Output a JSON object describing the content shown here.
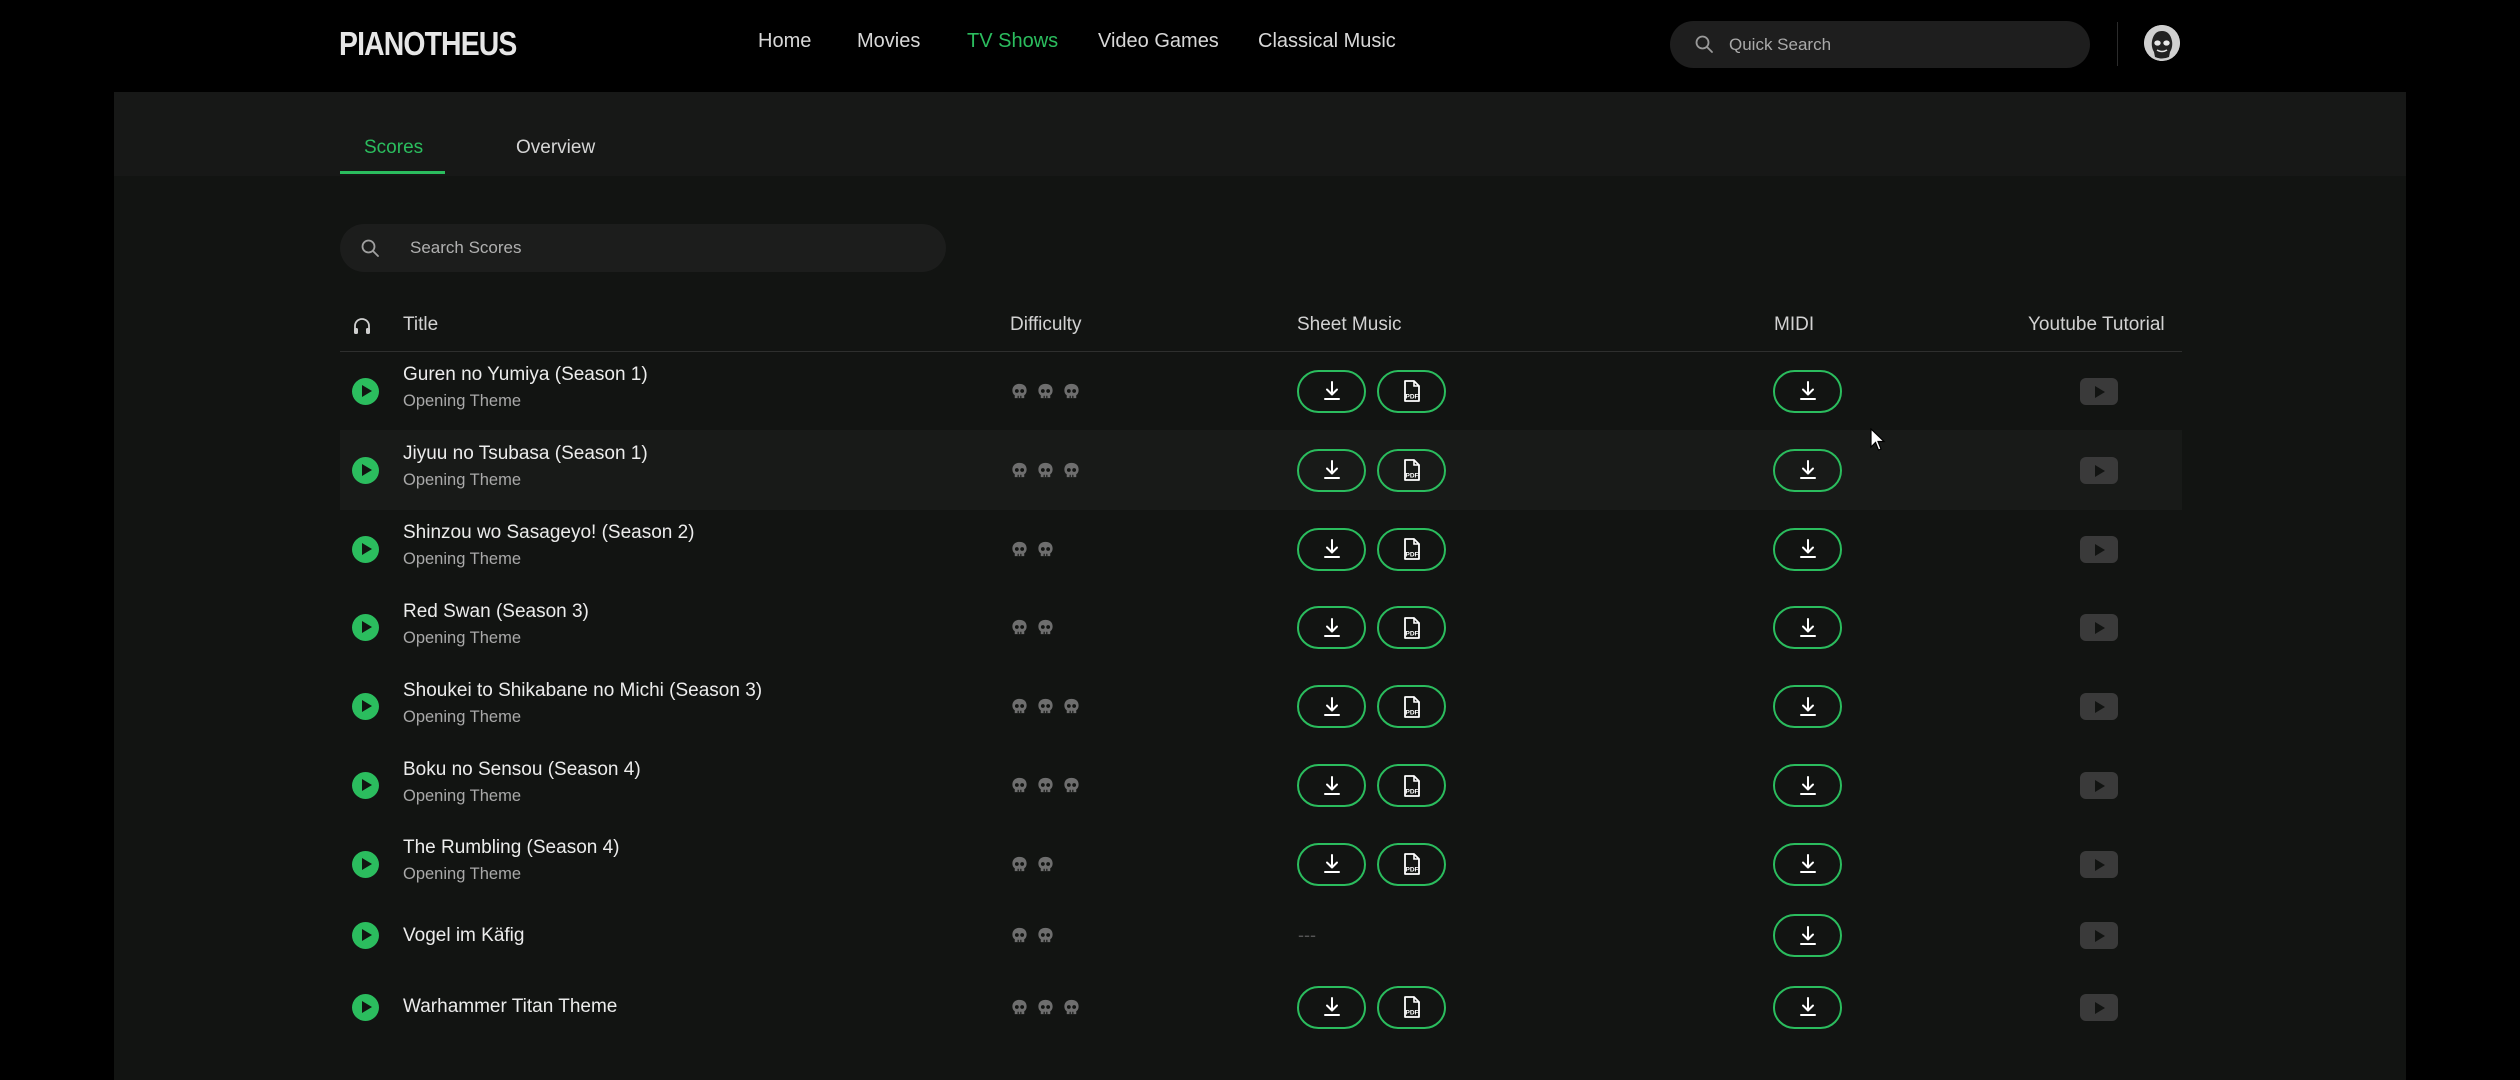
{
  "app": {
    "logo": "PIANOTHEUS"
  },
  "nav": {
    "items": [
      {
        "label": "Home",
        "active": false
      },
      {
        "label": "Movies",
        "active": false
      },
      {
        "label": "TV Shows",
        "active": true
      },
      {
        "label": "Video Games",
        "active": false
      },
      {
        "label": "Classical Music",
        "active": false
      }
    ],
    "search_placeholder": "Quick Search"
  },
  "tabs": [
    {
      "label": "Scores",
      "active": true
    },
    {
      "label": "Overview",
      "active": false
    }
  ],
  "scores_search": {
    "placeholder": "Search Scores"
  },
  "table": {
    "headers": {
      "title": "Title",
      "difficulty": "Difficulty",
      "sheet_music": "Sheet Music",
      "midi": "MIDI",
      "youtube": "Youtube Tutorial"
    },
    "rows": [
      {
        "title": "Guren no Yumiya (Season 1)",
        "subtitle": "Opening Theme",
        "difficulty": 3,
        "sheet_music": true
      },
      {
        "title": "Jiyuu no Tsubasa (Season 1)",
        "subtitle": "Opening Theme",
        "difficulty": 3,
        "sheet_music": true
      },
      {
        "title": "Shinzou wo Sasageyo! (Season 2)",
        "subtitle": "Opening Theme",
        "difficulty": 2,
        "sheet_music": true
      },
      {
        "title": "Red Swan (Season 3)",
        "subtitle": "Opening Theme",
        "difficulty": 2,
        "sheet_music": true
      },
      {
        "title": "Shoukei to Shikabane no Michi (Season 3)",
        "subtitle": "Opening Theme",
        "difficulty": 3,
        "sheet_music": true
      },
      {
        "title": "Boku no Sensou (Season 4)",
        "subtitle": "Opening Theme",
        "difficulty": 3,
        "sheet_music": true
      },
      {
        "title": "The Rumbling (Season 4)",
        "subtitle": "Opening Theme",
        "difficulty": 2,
        "sheet_music": true
      },
      {
        "title": "Vogel im Käfig",
        "subtitle": "",
        "difficulty": 2,
        "sheet_music": false,
        "sheet_placeholder": "---"
      },
      {
        "title": "Warhammer Titan Theme",
        "subtitle": "",
        "difficulty": 3,
        "sheet_music": true
      }
    ]
  },
  "colors": {
    "accent": "#2bbd5e",
    "background": "#121412",
    "topbar": "#000000"
  },
  "icons": [
    "search-icon",
    "headphones-icon",
    "play-icon",
    "skull-icon",
    "download-icon",
    "pdf-icon",
    "youtube-icon",
    "avatar-icon"
  ]
}
